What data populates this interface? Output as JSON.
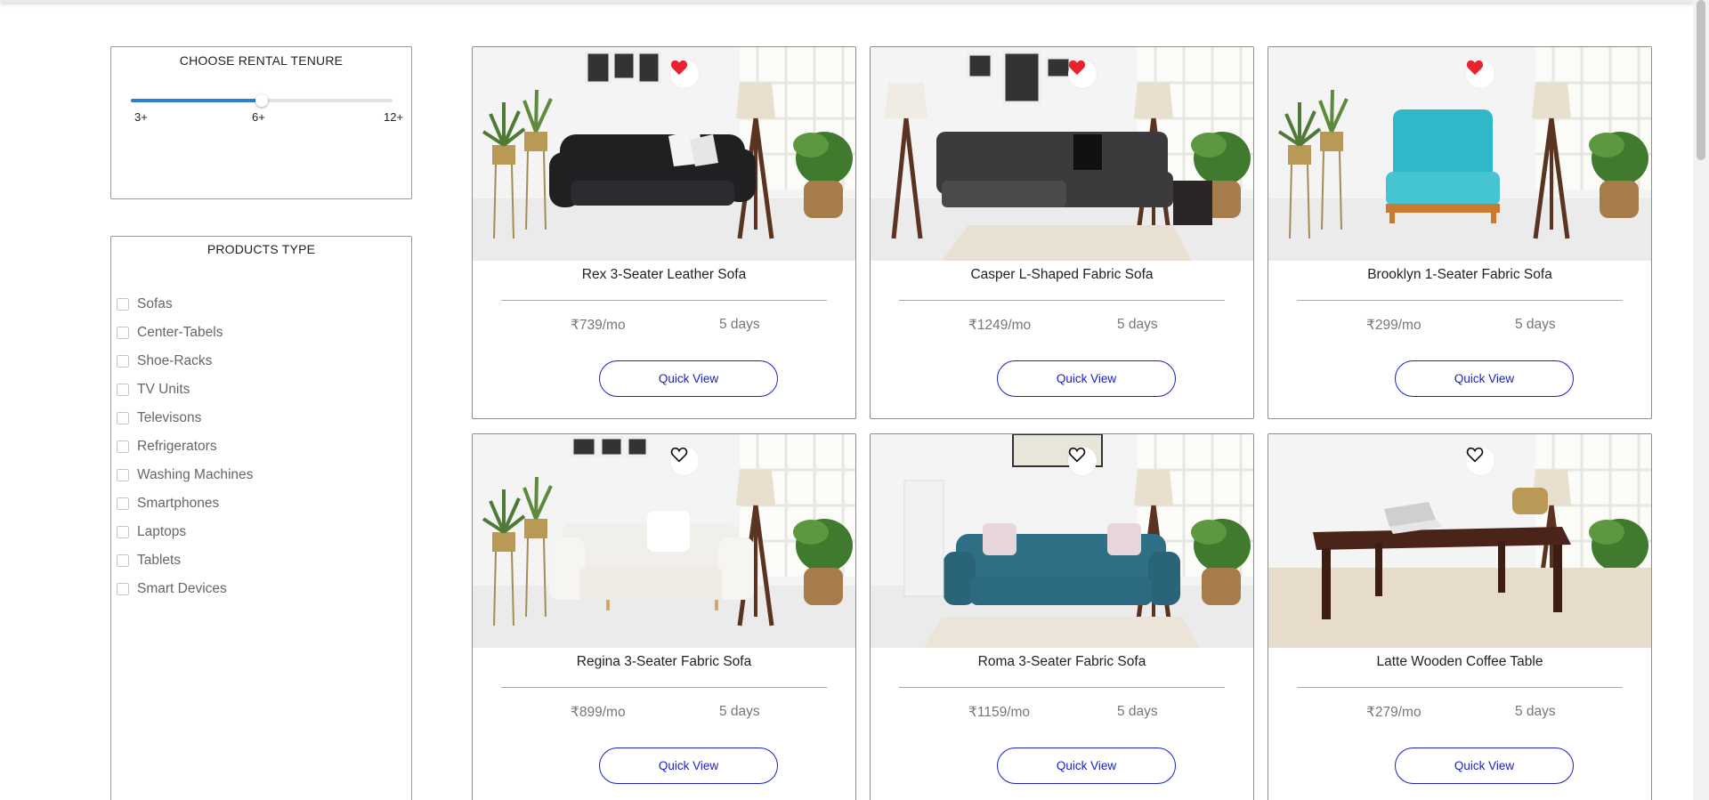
{
  "tenure": {
    "title": "CHOOSE RENTAL TENURE",
    "ticks": [
      "3+",
      "6+",
      "12+"
    ],
    "selected": "6+",
    "slider_fraction": 0.5
  },
  "products_type": {
    "title": "PRODUCTS TYPE",
    "items": [
      {
        "label": "Sofas"
      },
      {
        "label": "Center-Tabels"
      },
      {
        "label": "Shoe-Racks"
      },
      {
        "label": "TV Units"
      },
      {
        "label": "Televisons"
      },
      {
        "label": "Refrigerators"
      },
      {
        "label": "Washing Machines"
      },
      {
        "label": "Smartphones"
      },
      {
        "label": "Laptops"
      },
      {
        "label": "Tablets"
      },
      {
        "label": "Smart Devices"
      }
    ]
  },
  "products": [
    {
      "name": "Rex 3-Seater Leather Sofa",
      "price": "₹739/mo",
      "duration": "5 days",
      "button": "Quick View",
      "favorited": true,
      "image": "black-leather-sofa",
      "item_color": "#1f2022",
      "cushion_color": "#f4f4f4"
    },
    {
      "name": "Casper L-Shaped Fabric Sofa",
      "price": "₹1249/mo",
      "duration": "5 days",
      "button": "Quick View",
      "favorited": true,
      "image": "grey-l-shaped-sofa",
      "item_color": "#3b3a3d",
      "cushion_color": "#111111"
    },
    {
      "name": "Brooklyn 1-Seater Fabric Sofa",
      "price": "₹299/mo",
      "duration": "5 days",
      "button": "Quick View",
      "favorited": true,
      "image": "teal-single-seater",
      "item_color": "#2fb8c7",
      "cushion_color": "#45c4d2"
    },
    {
      "name": "Regina 3-Seater Fabric Sofa",
      "price": "₹899/mo",
      "duration": "5 days",
      "button": "Quick View",
      "favorited": false,
      "image": "white-fabric-sofa",
      "item_color": "#f1efea",
      "cushion_color": "#ffffff"
    },
    {
      "name": "Roma 3-Seater Fabric Sofa",
      "price": "₹1159/mo",
      "duration": "5 days",
      "button": "Quick View",
      "favorited": false,
      "image": "blue-fabric-sofa",
      "item_color": "#2f6f86",
      "cushion_color": "#e8d7da"
    },
    {
      "name": "Latte Wooden Coffee Table",
      "price": "₹279/mo",
      "duration": "5 days",
      "button": "Quick View",
      "favorited": false,
      "image": "wooden-coffee-table",
      "item_color": "#4a2419",
      "cushion_color": "#cfcfd2"
    }
  ],
  "colors": {
    "accent": "#1a20c9",
    "slider": "#2d7ed3",
    "heart": "#e8232d"
  }
}
